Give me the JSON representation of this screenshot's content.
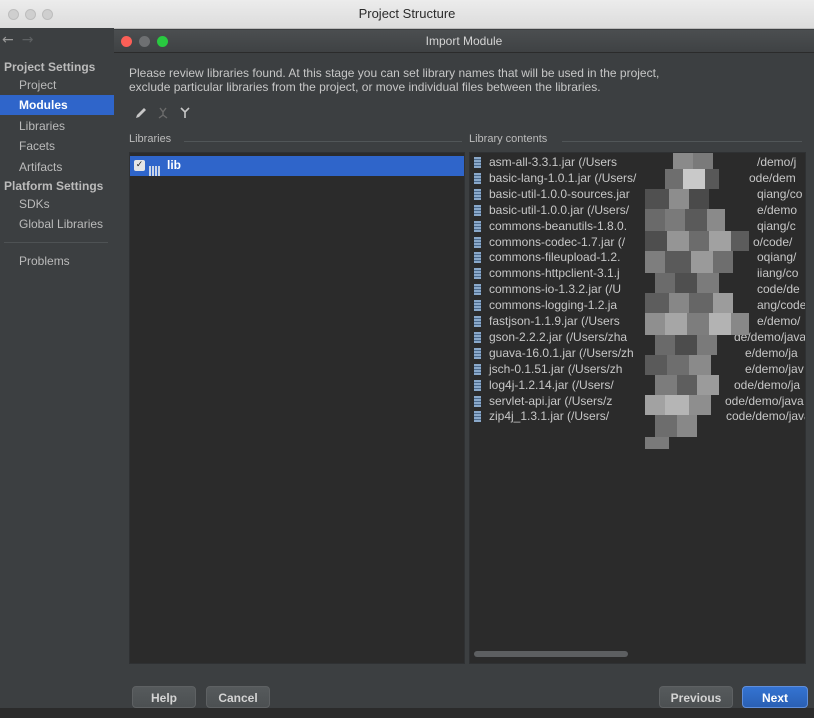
{
  "outer_window": {
    "title": "Project Structure"
  },
  "sidebar": {
    "sections": [
      {
        "header": "Project Settings",
        "items": [
          "Project",
          "Modules",
          "Libraries",
          "Facets",
          "Artifacts"
        ]
      },
      {
        "header": "Platform Settings",
        "items": [
          "SDKs",
          "Global Libraries"
        ]
      }
    ],
    "extra_items": [
      "Problems"
    ],
    "active_item": "Modules"
  },
  "dialog": {
    "title": "Import Module",
    "description_line1": "Please review libraries found. At this stage you can set library names that will be used in the project,",
    "description_line2": "exclude particular libraries from the project, or move individual files between the libraries.",
    "toolbar": {
      "icons": [
        "edit-icon",
        "merge-icon",
        "split-icon"
      ]
    },
    "libraries_label": "Libraries",
    "library_contents_label": "Library contents",
    "libraries": [
      {
        "name": "lib",
        "checked": true
      }
    ],
    "library_contents": [
      "asm-all-3.3.1.jar (/Users",
      "basic-lang-1.0.1.jar (/Users/",
      "basic-util-1.0.0-sources.jar",
      "basic-util-1.0.0.jar (/Users/",
      "commons-beanutils-1.8.0.",
      "commons-codec-1.7.jar (/",
      "commons-fileupload-1.2.",
      "commons-httpclient-3.1.j",
      "commons-io-1.3.2.jar (/U",
      "commons-logging-1.2.ja",
      "fastjson-1.1.9.jar (/Users",
      "gson-2.2.2.jar (/Users/zha",
      "guava-16.0.1.jar (/Users/zh",
      "jsch-0.1.51.jar (/Users/zh",
      "log4j-1.2.14.jar (/Users/",
      "servlet-api.jar (/Users/z",
      "zip4j_1.3.1.jar (/Users/"
    ],
    "library_contents_tails": [
      "/demo/j",
      "ode/dem",
      "qiang/co",
      "e/demo",
      "qiang/c",
      "o/code/",
      "oqiang/",
      "iiang/co",
      "code/de",
      "ang/code",
      "e/demo/",
      "de/demo/java",
      "e/demo/ja",
      "e/demo/jav",
      "ode/demo/ja",
      "ode/demo/java",
      "code/demo/java"
    ],
    "buttons": {
      "help": "Help",
      "cancel": "Cancel",
      "previous": "Previous",
      "next": "Next"
    }
  },
  "colors": {
    "accent": "#2f65ca",
    "background": "#3c3f41",
    "panel": "#2b2b2b"
  }
}
